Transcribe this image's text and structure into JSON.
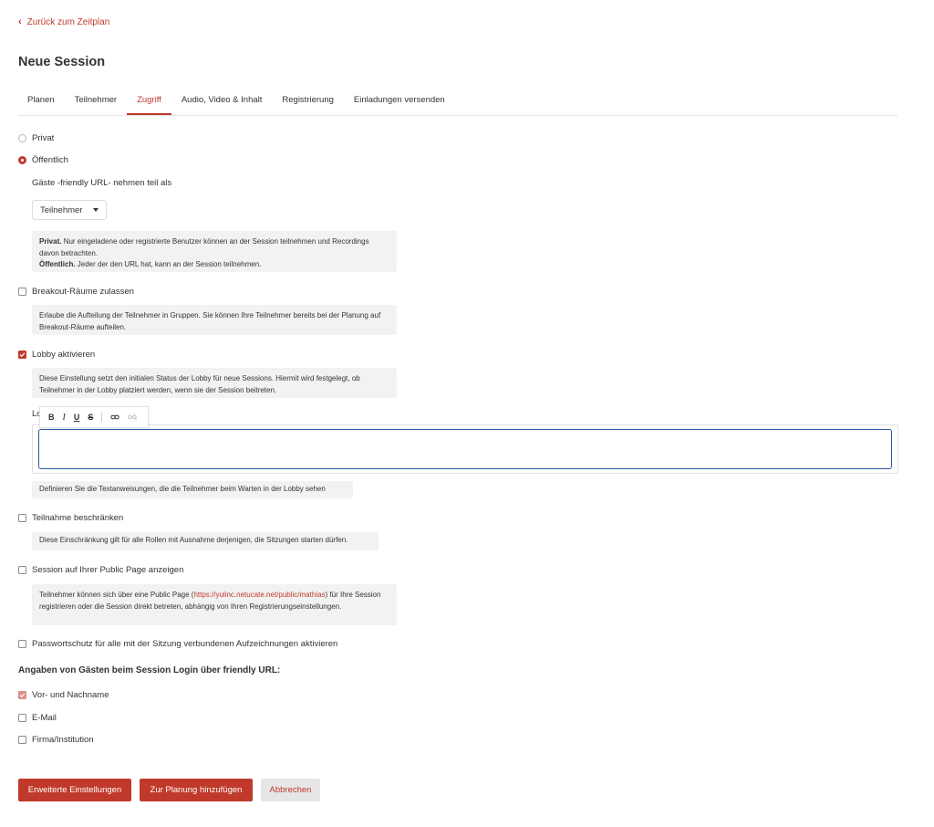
{
  "nav": {
    "back_label": "Zurück zum Zeitplan"
  },
  "page": {
    "title": "Neue Session"
  },
  "tabs": [
    {
      "label": "Planen"
    },
    {
      "label": "Teilnehmer"
    },
    {
      "label": "Zugriff",
      "active": true
    },
    {
      "label": "Audio, Video & Inhalt"
    },
    {
      "label": "Registrierung"
    },
    {
      "label": "Einladungen versenden"
    }
  ],
  "access": {
    "private_label": "Privat",
    "public_label": "Öffentlich",
    "selected": "public",
    "guest_label": "Gäste -friendly URL- nehmen teil als",
    "guest_role": "Teilnehmer",
    "info_private_bold": "Privat.",
    "info_private_text": " Nur eingeladene oder registrierte Benutzer können an der Session teilnehmen und Recordings davon betrachten.",
    "info_public_bold": "Öffentlich.",
    "info_public_text": " Jeder der den URL hat, kann an der Session teilnehmen."
  },
  "breakout": {
    "label": "Breakout-Räume zulassen",
    "checked": false,
    "info": "Erlaube die Aufteilung der Teilnehmer in Gruppen. Sie können Ihre Teilnehmer bereits bei der Planung auf Breakout-Räume aufteilen."
  },
  "lobby": {
    "label": "Lobby aktivieren",
    "checked": true,
    "info": "Diese Einstellung setzt den initialen Status der Lobby für neue Sessions. Hiermit wird festgelegt, ob Teilnehmer in der Lobby platziert werden, wenn sie der Session beitreten.",
    "field_label_fragment": "Lo",
    "editor_value": "",
    "editor_hint": "Definieren Sie die Textanweisungen, die die Teilnehmer beim Warten in der Lobby sehen",
    "toolbar": {
      "bold": "B",
      "italic": "I",
      "underline": "U",
      "strike": "S"
    }
  },
  "restrict": {
    "label": "Teilnahme beschränken",
    "checked": false,
    "info": "Diese Einschränkung gilt für alle Rollen mit Ausnahme derjenigen, die Sitzungen starten dürfen."
  },
  "public_page": {
    "label": "Session auf Ihrer Public Page anzeigen",
    "checked": false,
    "info_before": "Teilnehmer können sich über eine Public Page (",
    "info_link": "https://yulinc.netucate.net/public/mathias",
    "info_after": ") für Ihre Session registrieren oder die Session direkt betreten, abhängig von Ihren Registrierungseinstellungen."
  },
  "password": {
    "label": "Passwortschutz für alle mit der Sitzung verbundenen Aufzeichnungen aktivieren",
    "checked": false
  },
  "guest_fields": {
    "title": "Angaben von Gästen beim Session Login über friendly URL:",
    "items": [
      {
        "label": "Vor- und Nachname",
        "checked": true,
        "disabled": true
      },
      {
        "label": "E-Mail",
        "checked": false
      },
      {
        "label": "Firma/Institution",
        "checked": false
      }
    ]
  },
  "actions": {
    "advanced": "Erweiterte Einstellungen",
    "add": "Zur Planung hinzufügen",
    "cancel": "Abbrechen"
  },
  "colors": {
    "accent": "#c0392b",
    "focus": "#2b5aa8",
    "info_bg": "#f2f2f2"
  }
}
